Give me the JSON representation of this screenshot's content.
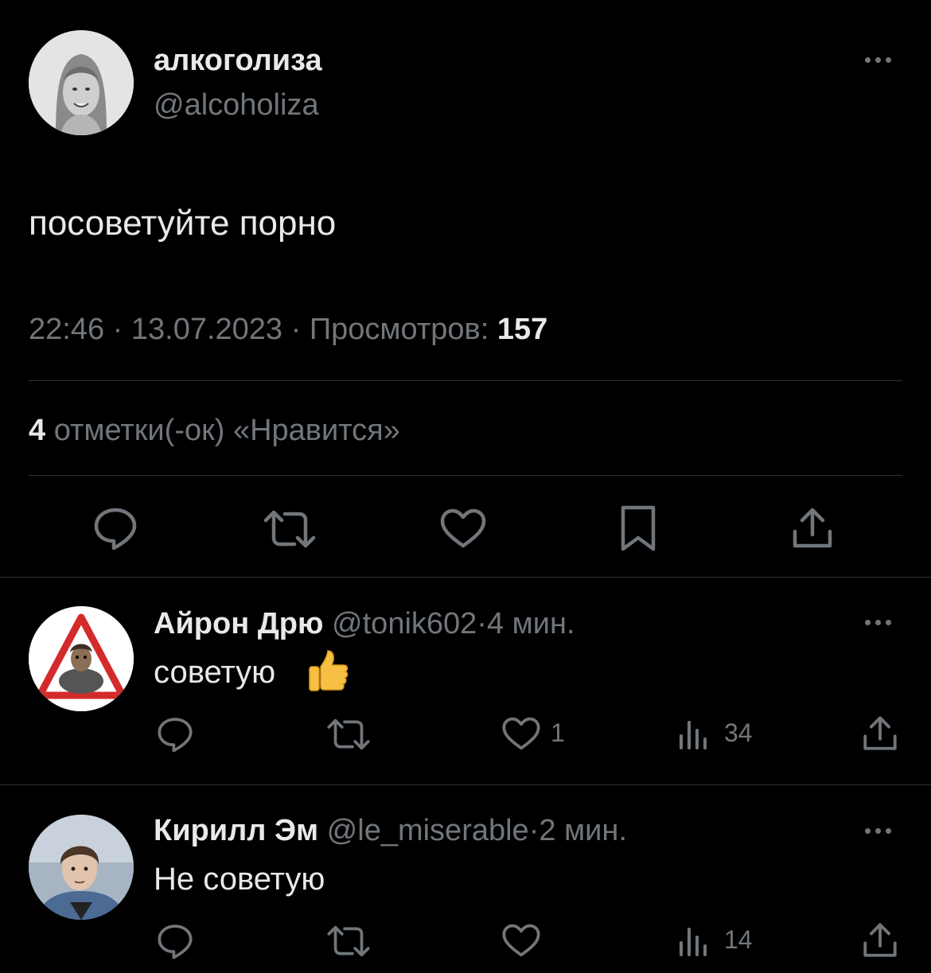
{
  "tweet": {
    "author_name": "алкоголиза",
    "author_handle": "@alcoholiza",
    "text": "посоветуйте порно",
    "time": "22:46",
    "date": "13.07.2023",
    "views_label": "Просмотров:",
    "views_count": "157",
    "likes_count": "4",
    "likes_label": "отметки(-ок) «Нравится»",
    "icons": [
      "more-icon",
      "reply-icon",
      "retweet-icon",
      "like-icon",
      "bookmark-icon",
      "share-icon"
    ]
  },
  "replies": [
    {
      "name": "Айрон Дрю",
      "handle": "@tonik602",
      "time": "4 мин.",
      "text": "советую",
      "emoji": "👍",
      "likes": "1",
      "views": "34"
    },
    {
      "name": "Кирилл Эм",
      "handle": "@le_miserable",
      "time": "2 мин.",
      "text": "Не советую",
      "likes": "",
      "views": "14"
    }
  ],
  "separator": "·",
  "colors": {
    "background": "#000000",
    "text": "#e7e9ea",
    "secondary": "#71767b",
    "divider": "#2f3336"
  }
}
